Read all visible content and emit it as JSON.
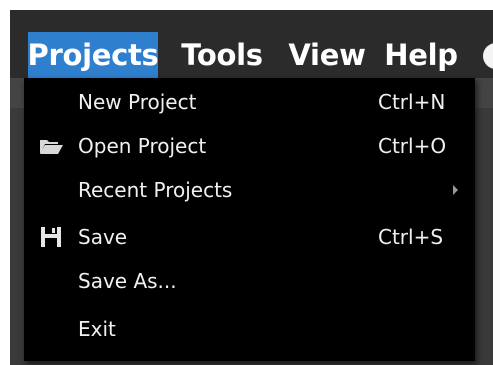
{
  "menubar": {
    "items": [
      {
        "label": "Projects",
        "active": true
      },
      {
        "label": "Tools",
        "active": false
      },
      {
        "label": "View",
        "active": false
      },
      {
        "label": "Help",
        "active": false
      }
    ]
  },
  "dropdown": {
    "items": [
      {
        "label": "New Project",
        "shortcut": "Ctrl+N",
        "icon": ""
      },
      {
        "label": "Open Project",
        "shortcut": "Ctrl+O",
        "icon": "folder-open-icon"
      },
      {
        "label": "Recent Projects",
        "shortcut": "",
        "icon": "",
        "submenu": true
      },
      {
        "label": "Save",
        "shortcut": "Ctrl+S",
        "icon": "floppy-disk-icon"
      },
      {
        "label": "Save As...",
        "shortcut": "",
        "icon": ""
      },
      {
        "label": "Exit",
        "shortcut": "",
        "icon": ""
      }
    ]
  },
  "colors": {
    "menubar_bg": "#2b2b2b",
    "active_menu": "#2f7fcf",
    "dropdown_bg": "#000000",
    "text": "#ffffff"
  }
}
